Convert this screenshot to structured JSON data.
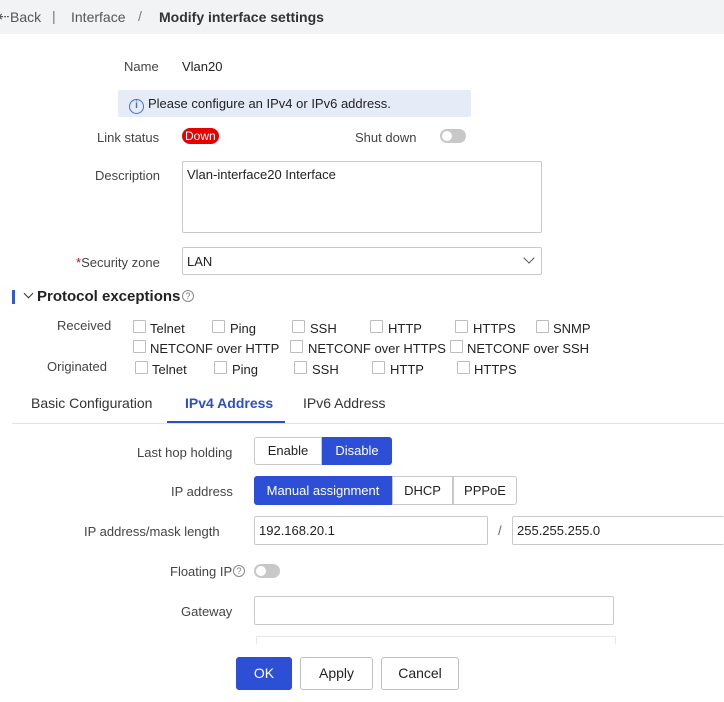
{
  "breadcrumb": {
    "back": "Back",
    "parent": "Interface",
    "separator": "/",
    "current": "Modify interface settings"
  },
  "form": {
    "name_label": "Name",
    "name_value": "Vlan20",
    "info_message": "Please configure an IPv4 or IPv6 address.",
    "link_status_label": "Link status",
    "link_status_value": "Down",
    "shutdown_label": "Shut down",
    "shutdown_on": false,
    "description_label": "Description",
    "description_value": "Vlan-interface20 Interface",
    "security_zone_required": "*",
    "security_zone_label": "Security zone",
    "security_zone_value": "LAN"
  },
  "protocol_exceptions": {
    "title": "Protocol exceptions",
    "received_label": "Received",
    "received_row1": [
      "Telnet",
      "Ping",
      "SSH",
      "HTTP",
      "HTTPS",
      "SNMP"
    ],
    "received_row2": [
      "NETCONF over HTTP",
      "NETCONF over HTTPS",
      "NETCONF over SSH"
    ],
    "originated_label": "Originated",
    "originated": [
      "Telnet",
      "Ping",
      "SSH",
      "HTTP",
      "HTTPS"
    ]
  },
  "tabs": [
    {
      "label": "Basic Configuration",
      "active": false
    },
    {
      "label": "IPv4 Address",
      "active": true
    },
    {
      "label": "IPv6 Address",
      "active": false
    }
  ],
  "ipv4": {
    "last_hop_label": "Last hop holding",
    "last_hop_options": [
      "Enable",
      "Disable"
    ],
    "last_hop_selected": "Disable",
    "ip_address_label": "IP address",
    "ip_address_options": [
      "Manual assignment",
      "DHCP",
      "PPPoE"
    ],
    "ip_address_selected": "Manual assignment",
    "ip_mask_label": "IP address/mask length",
    "ip_value": "192.168.20.1",
    "mask_separator": "/",
    "mask_value": "255.255.255.0",
    "floating_ip_label": "Floating IP",
    "floating_ip_on": false,
    "gateway_label": "Gateway",
    "gateway_value": ""
  },
  "actions": {
    "ok": "OK",
    "apply": "Apply",
    "cancel": "Cancel"
  },
  "colors": {
    "primary": "#2d4fd6",
    "danger": "#e60000",
    "info_bg": "#e6ecf7"
  }
}
